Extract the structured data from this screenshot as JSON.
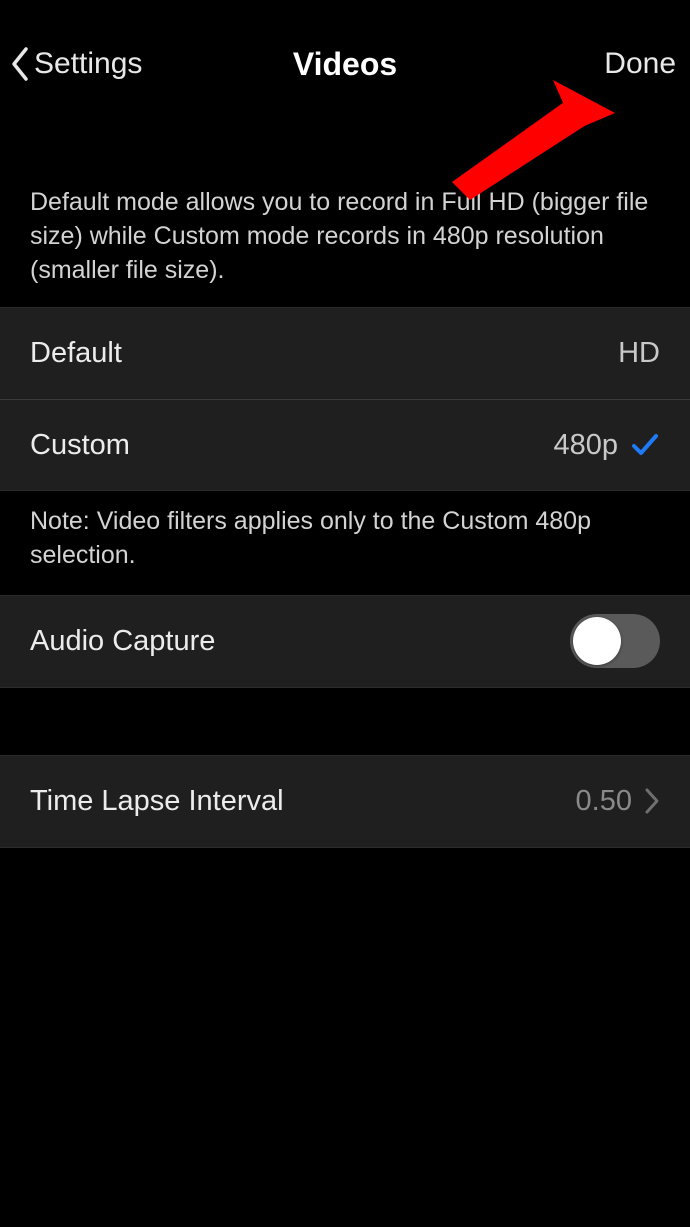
{
  "nav": {
    "back_label": "Settings",
    "title": "Videos",
    "done_label": "Done"
  },
  "mode_section": {
    "header": "Default mode allows you to record in Full HD (bigger file size) while Custom mode records in 480p resolution (smaller file size).",
    "items": {
      "default": {
        "label": "Default",
        "value": "HD",
        "selected": false
      },
      "custom": {
        "label": "Custom",
        "value": "480p",
        "selected": true
      }
    },
    "footer": "Note: Video filters applies only to the Custom 480p selection."
  },
  "audio": {
    "label": "Audio Capture",
    "enabled": false
  },
  "timelapse": {
    "label": "Time Lapse Interval",
    "value": "0.50"
  },
  "colors": {
    "accent": "#1f7af5",
    "annotation_arrow": "#ff0000"
  }
}
